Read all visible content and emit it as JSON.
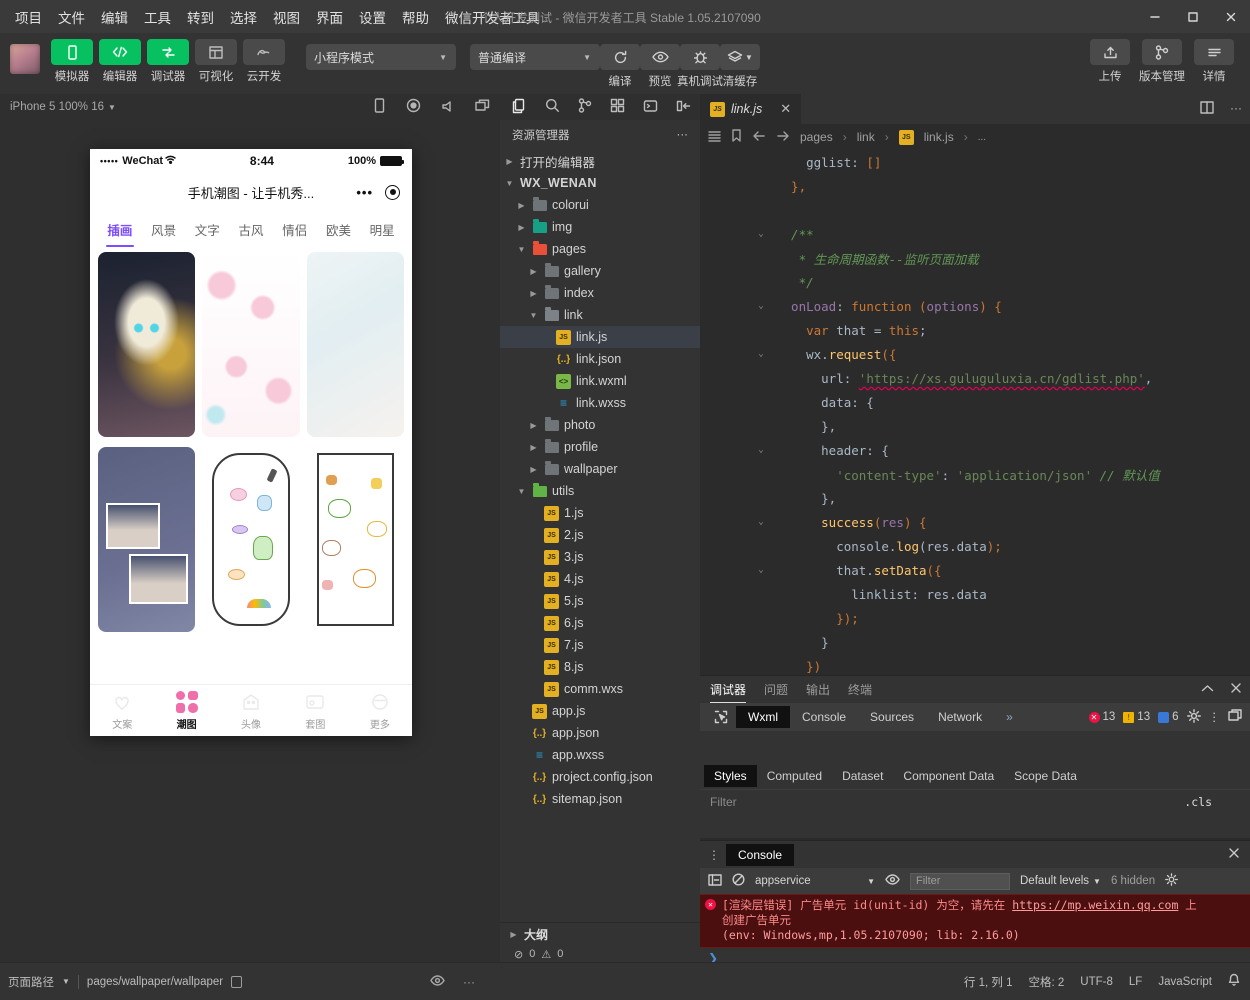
{
  "titlebar": {
    "menus": [
      "项目",
      "文件",
      "编辑",
      "工具",
      "转到",
      "选择",
      "视图",
      "界面",
      "设置",
      "帮助",
      "微信开发者工具"
    ],
    "window_title": "个人开发测试 - 微信开发者工具 Stable 1.05.2107090",
    "controls": {
      "minimize": "minimize-icon",
      "maximize": "maximize-icon",
      "close": "close-icon"
    }
  },
  "toolbar": {
    "avatar": "user-avatar",
    "left_buttons": [
      {
        "label": "模拟器",
        "icon": "phone-icon",
        "active": true
      },
      {
        "label": "编辑器",
        "icon": "code-icon",
        "active": true
      },
      {
        "label": "调试器",
        "icon": "debug-icon",
        "active": true
      },
      {
        "label": "可视化",
        "icon": "layout-icon",
        "active": false
      },
      {
        "label": "云开发",
        "icon": "cloud-icon",
        "active": false
      }
    ],
    "mode_select": "小程序模式",
    "compile_select": "普通编译",
    "actions": [
      {
        "label": "编译",
        "icon": "refresh-icon"
      },
      {
        "label": "预览",
        "icon": "eye-icon"
      },
      {
        "label": "真机调试",
        "icon": "bug-icon"
      },
      {
        "label": "清缓存",
        "icon": "layers-icon"
      }
    ],
    "right_buttons": [
      {
        "label": "上传",
        "icon": "upload-icon"
      },
      {
        "label": "版本管理",
        "icon": "branch-icon"
      },
      {
        "label": "详情",
        "icon": "info-icon"
      }
    ]
  },
  "simulator": {
    "device_label": "iPhone 5 100% 16",
    "toolbar_icons": [
      "rotate-icon",
      "record-icon",
      "volume-icon",
      "window-icon"
    ],
    "phone": {
      "status": {
        "carrier": "WeChat",
        "signal_dots": "•••••",
        "wifi": "wifi-icon",
        "time": "8:44",
        "battery_pct": "100%"
      },
      "nav_title": "手机潮图 - 让手机秀...",
      "nav_more": "•••",
      "nav_target": "target-icon",
      "tabs": [
        "插画",
        "风景",
        "文字",
        "古风",
        "情侣",
        "欧美",
        "明星"
      ],
      "active_tab": "插画",
      "cards": [
        {
          "name": "anime-girl-illustration"
        },
        {
          "name": "pink-pattern-illustration"
        },
        {
          "name": "pastel-gradient-illustration"
        },
        {
          "name": "photo-collage-wallpaper"
        },
        {
          "name": "doodle-stickers-wallpaper"
        },
        {
          "name": "cat-frog-stickers-wallpaper"
        }
      ],
      "bottom_tabs": [
        {
          "label": "文案",
          "icon": "heart-balloon-icon",
          "active": false
        },
        {
          "label": "潮图",
          "icon": "grid-icon",
          "active": true
        },
        {
          "label": "头像",
          "icon": "avatar-icon",
          "active": false
        },
        {
          "label": "套图",
          "icon": "album-icon",
          "active": false
        },
        {
          "label": "更多",
          "icon": "more-icon",
          "active": false
        }
      ]
    }
  },
  "activity_bar": {
    "icons": [
      "files-icon",
      "search-icon",
      "source-control-icon",
      "extensions-icon",
      "debug-icon",
      "panel-icon"
    ]
  },
  "explorer": {
    "title": "资源管理器",
    "more": "···",
    "tree": [
      {
        "depth": 0,
        "label": "打开的编辑器",
        "type": "section",
        "arrow": "collapsed"
      },
      {
        "depth": 0,
        "label": "WX_WENAN",
        "type": "root",
        "arrow": "expanded"
      },
      {
        "depth": 1,
        "label": "colorui",
        "type": "folder",
        "color": "grey",
        "arrow": "collapsed"
      },
      {
        "depth": 1,
        "label": "img",
        "type": "folder",
        "color": "teal",
        "arrow": "collapsed"
      },
      {
        "depth": 1,
        "label": "pages",
        "type": "folder",
        "color": "red",
        "arrow": "expanded"
      },
      {
        "depth": 2,
        "label": "gallery",
        "type": "folder",
        "color": "grey",
        "arrow": "collapsed"
      },
      {
        "depth": 2,
        "label": "index",
        "type": "folder",
        "color": "grey",
        "arrow": "collapsed"
      },
      {
        "depth": 2,
        "label": "link",
        "type": "folder",
        "color": "open",
        "arrow": "expanded"
      },
      {
        "depth": 3,
        "label": "link.js",
        "type": "js",
        "selected": true
      },
      {
        "depth": 3,
        "label": "link.json",
        "type": "json"
      },
      {
        "depth": 3,
        "label": "link.wxml",
        "type": "wxml"
      },
      {
        "depth": 3,
        "label": "link.wxss",
        "type": "wxss"
      },
      {
        "depth": 2,
        "label": "photo",
        "type": "folder",
        "color": "grey",
        "arrow": "collapsed"
      },
      {
        "depth": 2,
        "label": "profile",
        "type": "folder",
        "color": "grey",
        "arrow": "collapsed"
      },
      {
        "depth": 2,
        "label": "wallpaper",
        "type": "folder",
        "color": "grey",
        "arrow": "collapsed"
      },
      {
        "depth": 1,
        "label": "utils",
        "type": "folder",
        "color": "green",
        "arrow": "expanded"
      },
      {
        "depth": 2,
        "label": "1.js",
        "type": "js"
      },
      {
        "depth": 2,
        "label": "2.js",
        "type": "js"
      },
      {
        "depth": 2,
        "label": "3.js",
        "type": "js"
      },
      {
        "depth": 2,
        "label": "4.js",
        "type": "js"
      },
      {
        "depth": 2,
        "label": "5.js",
        "type": "js"
      },
      {
        "depth": 2,
        "label": "6.js",
        "type": "js"
      },
      {
        "depth": 2,
        "label": "7.js",
        "type": "js"
      },
      {
        "depth": 2,
        "label": "8.js",
        "type": "js"
      },
      {
        "depth": 2,
        "label": "comm.wxs",
        "type": "js"
      },
      {
        "depth": 1,
        "label": "app.js",
        "type": "js"
      },
      {
        "depth": 1,
        "label": "app.json",
        "type": "json"
      },
      {
        "depth": 1,
        "label": "app.wxss",
        "type": "wxss"
      },
      {
        "depth": 1,
        "label": "project.config.json",
        "type": "json"
      },
      {
        "depth": 1,
        "label": "sitemap.json",
        "type": "json"
      }
    ],
    "outline": {
      "title": "大纲",
      "errors": "0",
      "warnings": "0"
    }
  },
  "editor": {
    "tab": {
      "label": "link.js",
      "icon": "js-icon",
      "close": "close-icon"
    },
    "tab_actions": [
      "split-editor-icon",
      "more-icon"
    ],
    "breadcrumb_icons": [
      "outline-icon",
      "bookmark-icon",
      "back-arrow-icon",
      "forward-arrow-icon"
    ],
    "breadcrumbs": [
      "pages",
      "link",
      "link.js",
      "..."
    ],
    "lines": [
      {
        "fold": "",
        "tokens": [
          {
            "t": "    gglist: ",
            "c": "p"
          },
          {
            "t": "[]",
            "c": "br"
          }
        ]
      },
      {
        "fold": "",
        "tokens": [
          {
            "t": "  },",
            "c": "br"
          }
        ]
      },
      {
        "fold": "",
        "tokens": []
      },
      {
        "fold": "v",
        "tokens": [
          {
            "t": "  /**",
            "c": "c"
          }
        ]
      },
      {
        "fold": "",
        "tokens": [
          {
            "t": "   * 生命周期函数--监听页面加载",
            "c": "c"
          }
        ]
      },
      {
        "fold": "",
        "tokens": [
          {
            "t": "   */",
            "c": "c"
          }
        ]
      },
      {
        "fold": "v",
        "tokens": [
          {
            "t": "  onLoad",
            "c": "v"
          },
          {
            "t": ": ",
            "c": "p"
          },
          {
            "t": "function ",
            "c": "k"
          },
          {
            "t": "(",
            "c": "br"
          },
          {
            "t": "options",
            "c": "v"
          },
          {
            "t": ") {",
            "c": "br"
          }
        ]
      },
      {
        "fold": "",
        "tokens": [
          {
            "t": "    ",
            "c": "p"
          },
          {
            "t": "var ",
            "c": "k"
          },
          {
            "t": "that = ",
            "c": "p"
          },
          {
            "t": "this",
            "c": "k"
          },
          {
            "t": ";",
            "c": "p"
          }
        ]
      },
      {
        "fold": "v",
        "tokens": [
          {
            "t": "    wx.",
            "c": "p"
          },
          {
            "t": "request",
            "c": "f"
          },
          {
            "t": "({",
            "c": "br"
          }
        ]
      },
      {
        "fold": "",
        "tokens": [
          {
            "t": "      url: ",
            "c": "p"
          },
          {
            "t": "'https://xs.guluguluxia.cn/gdlist.php'",
            "c": "err"
          },
          {
            "t": ",",
            "c": "p"
          }
        ]
      },
      {
        "fold": "",
        "tokens": [
          {
            "t": "      data: {",
            "c": "p"
          }
        ]
      },
      {
        "fold": "",
        "tokens": [
          {
            "t": "      },",
            "c": "p"
          }
        ]
      },
      {
        "fold": "v",
        "tokens": [
          {
            "t": "      header: {",
            "c": "p"
          }
        ]
      },
      {
        "fold": "",
        "tokens": [
          {
            "t": "        'content-type'",
            "c": "s"
          },
          {
            "t": ": ",
            "c": "p"
          },
          {
            "t": "'application/json'",
            "c": "s"
          },
          {
            "t": " ",
            "c": "p"
          },
          {
            "t": "// 默认值",
            "c": "c"
          }
        ]
      },
      {
        "fold": "",
        "tokens": [
          {
            "t": "      },",
            "c": "p"
          }
        ]
      },
      {
        "fold": "v",
        "tokens": [
          {
            "t": "      ",
            "c": "p"
          },
          {
            "t": "success",
            "c": "f"
          },
          {
            "t": "(",
            "c": "br"
          },
          {
            "t": "res",
            "c": "v"
          },
          {
            "t": ") {",
            "c": "br"
          }
        ]
      },
      {
        "fold": "",
        "tokens": [
          {
            "t": "        console.",
            "c": "p"
          },
          {
            "t": "log",
            "c": "f"
          },
          {
            "t": "(res.data",
            "c": "p"
          },
          {
            "t": ");",
            "c": "br"
          }
        ]
      },
      {
        "fold": "v",
        "tokens": [
          {
            "t": "        that.",
            "c": "p"
          },
          {
            "t": "setData",
            "c": "f"
          },
          {
            "t": "({",
            "c": "br"
          }
        ]
      },
      {
        "fold": "",
        "tokens": [
          {
            "t": "          linklist: res.data",
            "c": "p"
          }
        ]
      },
      {
        "fold": "",
        "tokens": [
          {
            "t": "        ",
            "c": "p"
          },
          {
            "t": "});",
            "c": "br"
          }
        ]
      },
      {
        "fold": "",
        "tokens": [
          {
            "t": "      }",
            "c": "p"
          }
        ]
      },
      {
        "fold": "",
        "tokens": [
          {
            "t": "    ",
            "c": "p"
          },
          {
            "t": "})",
            "c": "br"
          }
        ]
      }
    ]
  },
  "debugger": {
    "panel_tabs": [
      "调试器",
      "问题",
      "输出",
      "终端"
    ],
    "panel_active": "调试器",
    "panel_actions": [
      "chevron-up-icon",
      "close-icon"
    ],
    "devtools_tabs": [
      "Wxml",
      "Console",
      "Sources",
      "Network"
    ],
    "devtools_active": "Wxml",
    "devtools_overflow": "»",
    "inspect_icon": "inspect-element-icon",
    "counts": {
      "errors": "13",
      "warnings": "13",
      "info": "6"
    },
    "devtools_right_icons": [
      "gear-icon",
      "kebab-icon",
      "dock-icon"
    ],
    "style_tabs": [
      "Styles",
      "Computed",
      "Dataset",
      "Component Data",
      "Scope Data"
    ],
    "style_active": "Styles",
    "filter_placeholder": "Filter",
    "cls_label": ".cls"
  },
  "console": {
    "title": "Console",
    "close": "close-icon",
    "toolbar_icons": [
      "sidebar-icon",
      "clear-icon",
      "eye-icon",
      "gear-icon"
    ],
    "context": "appservice",
    "filter_placeholder": "Filter",
    "levels": "Default levels",
    "hidden": "6 hidden",
    "error": {
      "line1_a": "[渲染层错误] 广告单元 id(unit-id) 为空，请先在 ",
      "link": "https://mp.weixin.qq.com",
      "line1_b": " 上",
      "line2": "创建广告单元",
      "line3": "(env: Windows,mp,1.05.2107090; lib: 2.16.0)"
    },
    "prompt": "❯"
  },
  "status_bar": {
    "page_path_label": "页面路径",
    "page_path": "pages/wallpaper/wallpaper",
    "copy_icon": "copy-icon",
    "eye_icon": "eye-icon",
    "more_icon": "more-icon",
    "right": [
      "行 1, 列 1",
      "空格: 2",
      "UTF-8",
      "LF",
      "JavaScript"
    ],
    "bell_icon": "bell-icon"
  },
  "colors": {
    "accent_green": "#07c160",
    "tab_purple": "#7c4dff",
    "error_red": "#4b0f10"
  }
}
